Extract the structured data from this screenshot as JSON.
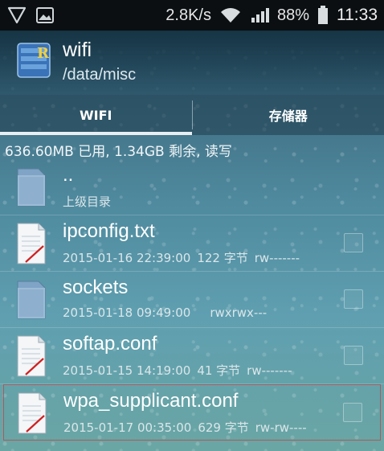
{
  "status_bar": {
    "net_speed": "2.8K/s",
    "battery": "88%",
    "time": "11:33",
    "icons": [
      "vpn-shield-icon",
      "image-notification-icon",
      "wifi-icon",
      "signal-icon",
      "battery-icon"
    ]
  },
  "header": {
    "title": "wifi",
    "path": "/data/misc",
    "app_icon": "root-explorer-icon"
  },
  "tabs": [
    {
      "label": "WIFI",
      "active": true
    },
    {
      "label": "存储器",
      "active": false
    }
  ],
  "storage_info": "636.60MB 已用, 1.34GB 剩余, 读写",
  "files": [
    {
      "name": "..",
      "date": "",
      "size": "",
      "perms": "",
      "subtitle": "上级目录",
      "type": "folder"
    },
    {
      "name": "ipconfig.txt",
      "date": "2015-01-16 22:39:00",
      "size": "122 字节",
      "perms": "rw-------",
      "type": "file"
    },
    {
      "name": "sockets",
      "date": "2015-01-18 09:49:00",
      "size": "",
      "perms": "rwxrwx---",
      "type": "folder"
    },
    {
      "name": "softap.conf",
      "date": "2015-01-15 14:19:00",
      "size": "41 字节",
      "perms": "rw-------",
      "type": "file"
    },
    {
      "name": "wpa_supplicant.conf",
      "date": "2015-01-17 00:35:00",
      "size": "629 字节",
      "perms": "rw-rw----",
      "type": "file"
    }
  ],
  "colors": {
    "status_bar_bg": "#0b0f12",
    "tab_indicator": "#e8eef2",
    "selected_border": "#c83c3c"
  }
}
